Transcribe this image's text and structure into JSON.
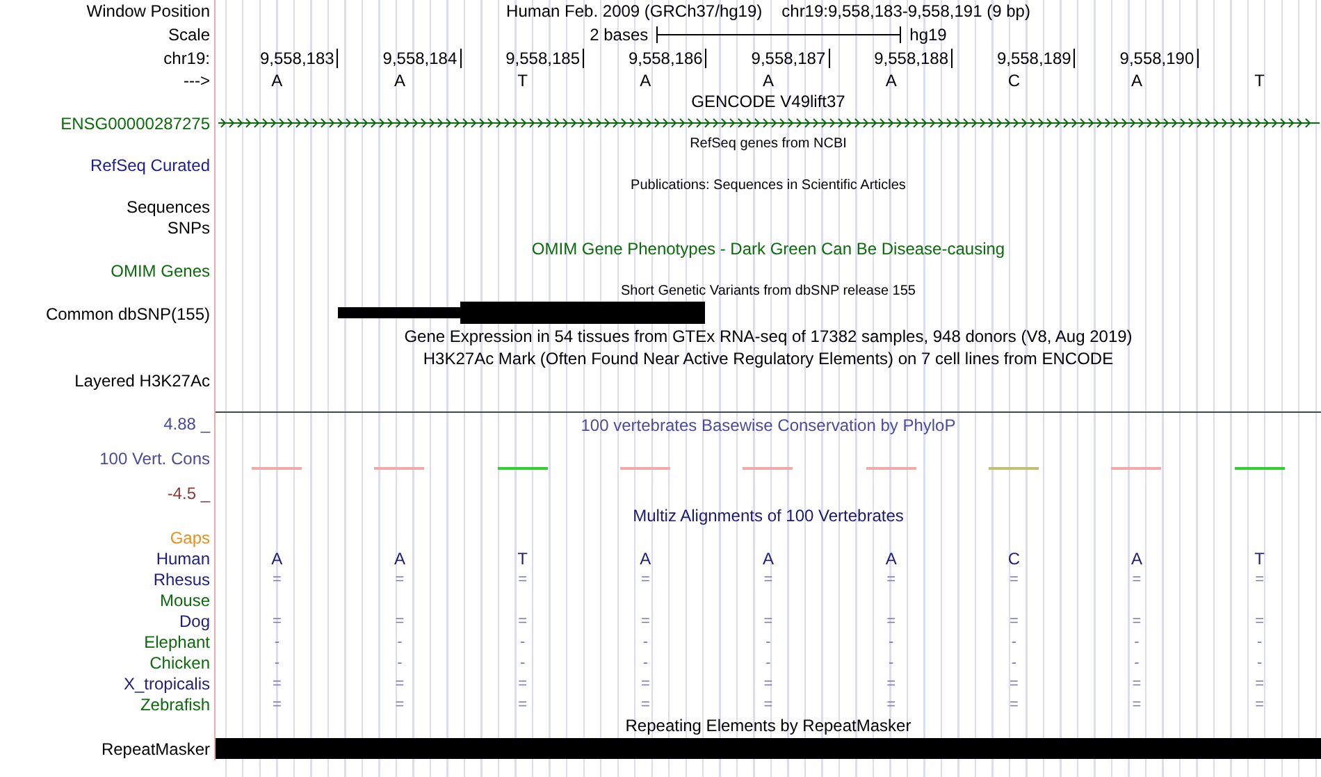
{
  "window_position": {
    "label": "Window Position",
    "assembly": "Human Feb. 2009 (GRCh37/hg19)",
    "position": "chr19:9,558,183-9,558,191 (9 bp)"
  },
  "scale": {
    "label": "Scale",
    "text": "2 bases",
    "assembly": "hg19"
  },
  "ruler": {
    "label": "chr19:",
    "positions": [
      "9,558,183",
      "9,558,184",
      "9,558,185",
      "9,558,186",
      "9,558,187",
      "9,558,188",
      "9,558,189",
      "9,558,190"
    ]
  },
  "strand": {
    "label": "--->",
    "bases": [
      "A",
      "A",
      "T",
      "A",
      "A",
      "A",
      "C",
      "A",
      "T"
    ]
  },
  "tracks": [
    {
      "kind": "title",
      "text": "GENCODE V49lift37",
      "color": "#000000"
    },
    {
      "kind": "gene",
      "label": "ENSG00000287275",
      "color": "#0b6b0b"
    },
    {
      "kind": "note",
      "text": "RefSeq genes from NCBI"
    },
    {
      "kind": "label",
      "label": "RefSeq Curated",
      "color": "#1e1e8a"
    },
    {
      "kind": "note",
      "text": "Publications: Sequences in Scientific Articles"
    },
    {
      "kind": "label",
      "label": "Sequences",
      "color": "#000000"
    },
    {
      "kind": "label",
      "label": "SNPs",
      "color": "#000000"
    },
    {
      "kind": "title",
      "text": "OMIM Gene Phenotypes - Dark Green Can Be Disease-causing",
      "color": "#0b6b0b"
    },
    {
      "kind": "label",
      "label": "OMIM Genes",
      "color": "#0b6b0b"
    },
    {
      "kind": "note",
      "text": "Short Genetic Variants from dbSNP release 155"
    },
    {
      "kind": "variants",
      "label": "Common dbSNP(155)",
      "color": "#000000"
    },
    {
      "kind": "title",
      "text": "Gene Expression in 54 tissues from GTEx RNA-seq of 17382 samples, 948 donors (V8, Aug 2019)",
      "color": "#000000"
    },
    {
      "kind": "title",
      "text": "H3K27Ac Mark (Often Found Near Active Regulatory Elements) on 7 cell lines from ENCODE",
      "color": "#000000"
    },
    {
      "kind": "label",
      "label": "Layered H3K27Ac",
      "color": "#000000"
    },
    {
      "kind": "wiggle",
      "label": "100 Vert. Cons",
      "color": "#4b4b9b",
      "title": "100 vertebrates Basewise Conservation by PhyloP",
      "upper_limit": "4.88 _",
      "lower_limit": {
        "text": "-4.5 _",
        "color": "#8b3a3a"
      },
      "segments": [
        {
          "color": "#f4a8a8"
        },
        {
          "color": "#f4a8a8"
        },
        {
          "color": "#30d030"
        },
        {
          "color": "#f4a8a8"
        },
        {
          "color": "#f4a8a8"
        },
        {
          "color": "#f4a8a8"
        },
        {
          "color": "#c0c070"
        },
        {
          "color": "#f4a8a8"
        },
        {
          "color": "#30d030"
        }
      ]
    },
    {
      "kind": "title",
      "text": "Multiz Alignments of 100 Vertebrates",
      "color": "#1a1a6e"
    },
    {
      "kind": "label",
      "label": "Gaps",
      "color": "#e8901a"
    },
    {
      "kind": "reference",
      "label": "Human",
      "color": "#1e1e7a",
      "cells": [
        "A",
        "A",
        "T",
        "A",
        "A",
        "A",
        "C",
        "A",
        "T"
      ]
    },
    {
      "kind": "species",
      "label": "Rhesus",
      "color": "#1e1e7a",
      "cells": [
        "=",
        "=",
        "=",
        "=",
        "=",
        "=",
        "=",
        "=",
        "="
      ]
    },
    {
      "kind": "species",
      "label": "Mouse",
      "color": "#0b6b0b"
    },
    {
      "kind": "species",
      "label": "Dog",
      "color": "#1e1e7a",
      "cells": [
        "=",
        "=",
        "=",
        "=",
        "=",
        "=",
        "=",
        "=",
        "="
      ]
    },
    {
      "kind": "species",
      "label": "Elephant",
      "color": "#0b6b0b",
      "cells": [
        "-",
        "-",
        "-",
        "-",
        "-",
        "-",
        "-",
        "-",
        "-"
      ]
    },
    {
      "kind": "species",
      "label": "Chicken",
      "color": "#0b6b0b",
      "cells": [
        "-",
        "-",
        "-",
        "-",
        "-",
        "-",
        "-",
        "-",
        "-"
      ]
    },
    {
      "kind": "species",
      "label": "X_tropicalis",
      "color": "#1e1e7a",
      "cells": [
        "=",
        "=",
        "=",
        "=",
        "=",
        "=",
        "=",
        "=",
        "="
      ]
    },
    {
      "kind": "species",
      "label": "Zebrafish",
      "color": "#0b6b0b",
      "cells": [
        "=",
        "=",
        "=",
        "=",
        "=",
        "=",
        "=",
        "=",
        "="
      ]
    },
    {
      "kind": "title",
      "text": "Repeating Elements by RepeatMasker",
      "color": "#000000"
    },
    {
      "kind": "repeat",
      "label": "RepeatMasker",
      "color": "#000000"
    }
  ]
}
